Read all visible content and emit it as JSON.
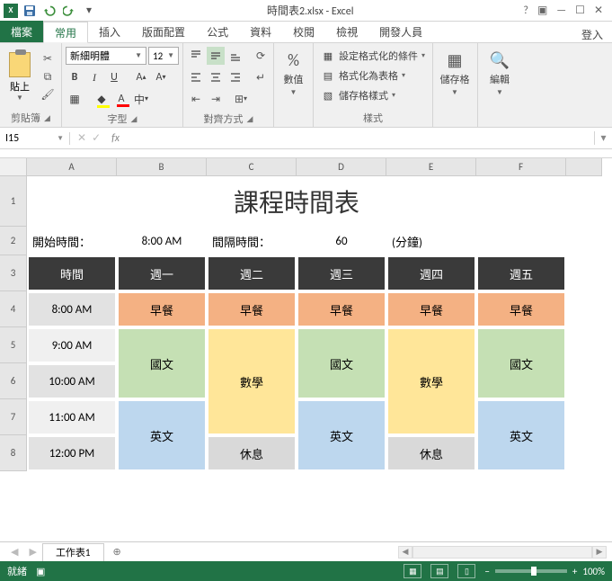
{
  "titlebar": {
    "title": "時間表2.xlsx - Excel"
  },
  "ribbon": {
    "file": "檔案",
    "tabs": [
      "常用",
      "插入",
      "版面配置",
      "公式",
      "資料",
      "校閱",
      "檢視",
      "開發人員"
    ],
    "active_tab_index": 0,
    "signin": "登入",
    "clipboard": {
      "paste": "貼上",
      "group_label": "剪貼簿"
    },
    "font": {
      "name": "新細明體",
      "size": "12",
      "group_label": "字型"
    },
    "alignment": {
      "group_label": "對齊方式"
    },
    "number": {
      "btn": "數值",
      "group_label": ""
    },
    "styles": {
      "cond": "設定格式化的條件",
      "table": "格式化為表格",
      "cell": "儲存格樣式",
      "group_label": "樣式"
    },
    "cells": {
      "btn": "儲存格"
    },
    "editing": {
      "btn": "編輯"
    }
  },
  "formula_bar": {
    "name_box": "I15",
    "fx": "fx"
  },
  "columns": [
    "A",
    "B",
    "C",
    "D",
    "E",
    "F"
  ],
  "rows": [
    "1",
    "2",
    "3",
    "4",
    "5",
    "6",
    "7",
    "8"
  ],
  "sheet": {
    "title": "課程時間表",
    "start_label": "開始時間：",
    "start_value": "8:00 AM",
    "interval_label": "間隔時間：",
    "interval_value": "60",
    "interval_unit": "(分鐘)",
    "header_time": "時間",
    "days": [
      "週一",
      "週二",
      "週三",
      "週四",
      "週五"
    ],
    "times": [
      "8:00 AM",
      "9:00 AM",
      "10:00 AM",
      "11:00 AM",
      "12:00 PM"
    ],
    "subjects": {
      "breakfast": "早餐",
      "chinese": "國文",
      "math": "數學",
      "english": "英文",
      "rest": "休息"
    }
  },
  "sheettab": {
    "name": "工作表1"
  },
  "status": {
    "ready": "就緒",
    "zoom": "100%"
  }
}
